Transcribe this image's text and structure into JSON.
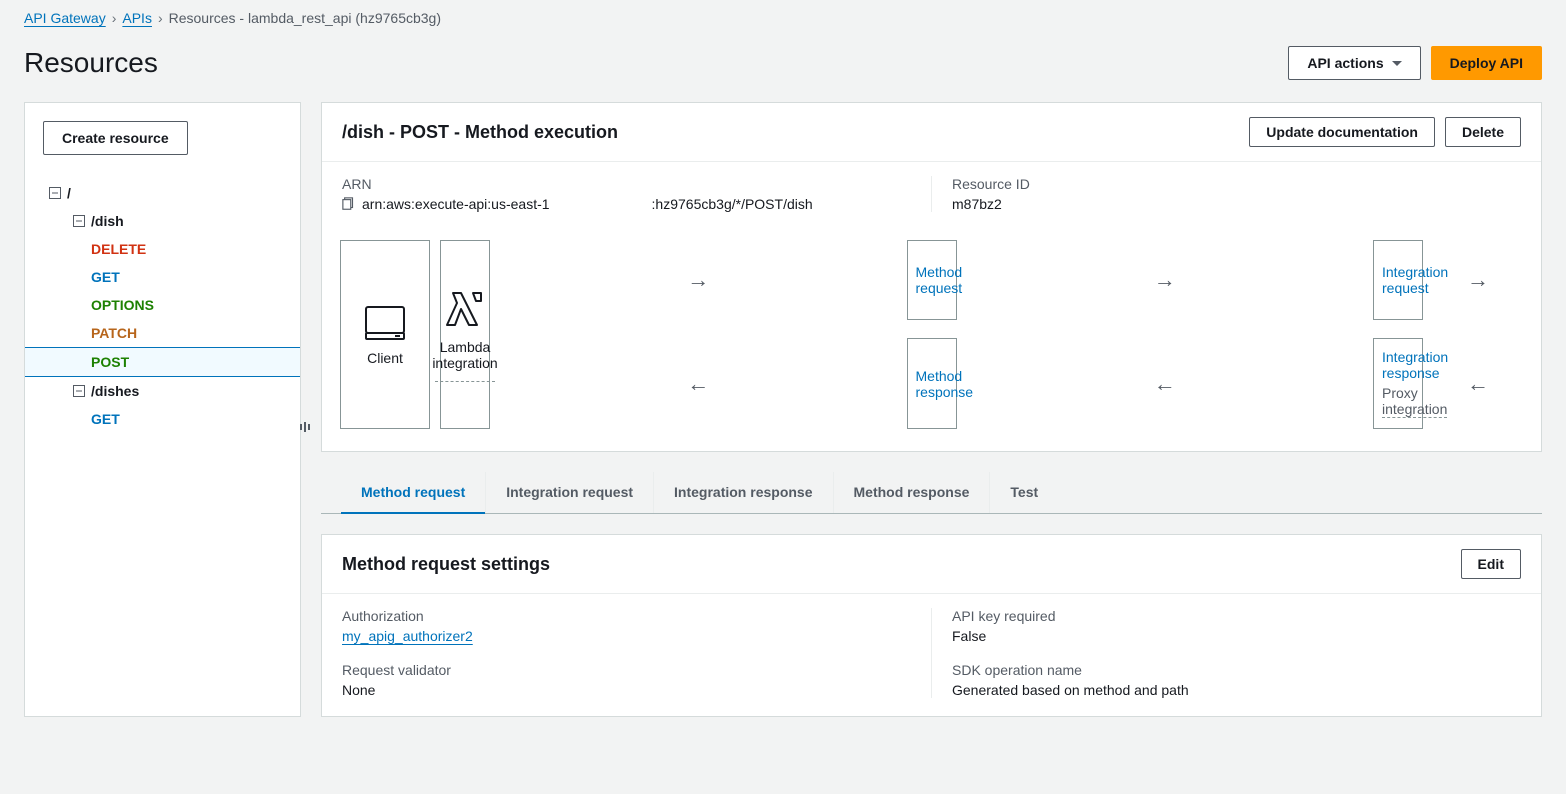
{
  "breadcrumb": {
    "root": "API Gateway",
    "apis": "APIs",
    "current": "Resources - lambda_rest_api (hz9765cb3g)"
  },
  "page": {
    "heading": "Resources",
    "api_actions": "API actions",
    "deploy": "Deploy API",
    "create_resource": "Create resource"
  },
  "tree": {
    "root": "/",
    "dish": "/dish",
    "dishes": "/dishes",
    "methods": {
      "delete": "DELETE",
      "get": "GET",
      "options": "OPTIONS",
      "patch": "PATCH",
      "post": "POST",
      "get2": "GET"
    }
  },
  "method_panel": {
    "title": "/dish - POST - Method execution",
    "update_doc": "Update documentation",
    "delete": "Delete",
    "arn_label": "ARN",
    "arn_part1": "arn:aws:execute-api:us-east-1",
    "arn_part2": ":hz9765cb3g/*/POST/dish",
    "resource_id_label": "Resource ID",
    "resource_id": "m87bz2"
  },
  "flow": {
    "client": "Client",
    "method_request": "Method request",
    "integration_request": "Integration request",
    "integration_response": "Integration response",
    "proxy": "Proxy integration",
    "method_response": "Method response",
    "lambda_label": "Lambda integration"
  },
  "tabs": {
    "method_request": "Method request",
    "integration_request": "Integration request",
    "integration_response": "Integration response",
    "method_response": "Method response",
    "test": "Test"
  },
  "settings": {
    "heading": "Method request settings",
    "edit": "Edit",
    "authorization_label": "Authorization",
    "authorization_value": "my_apig_authorizer2",
    "api_key_label": "API key required",
    "api_key_value": "False",
    "validator_label": "Request validator",
    "validator_value": "None",
    "sdk_label": "SDK operation name",
    "sdk_value": "Generated based on method and path"
  }
}
